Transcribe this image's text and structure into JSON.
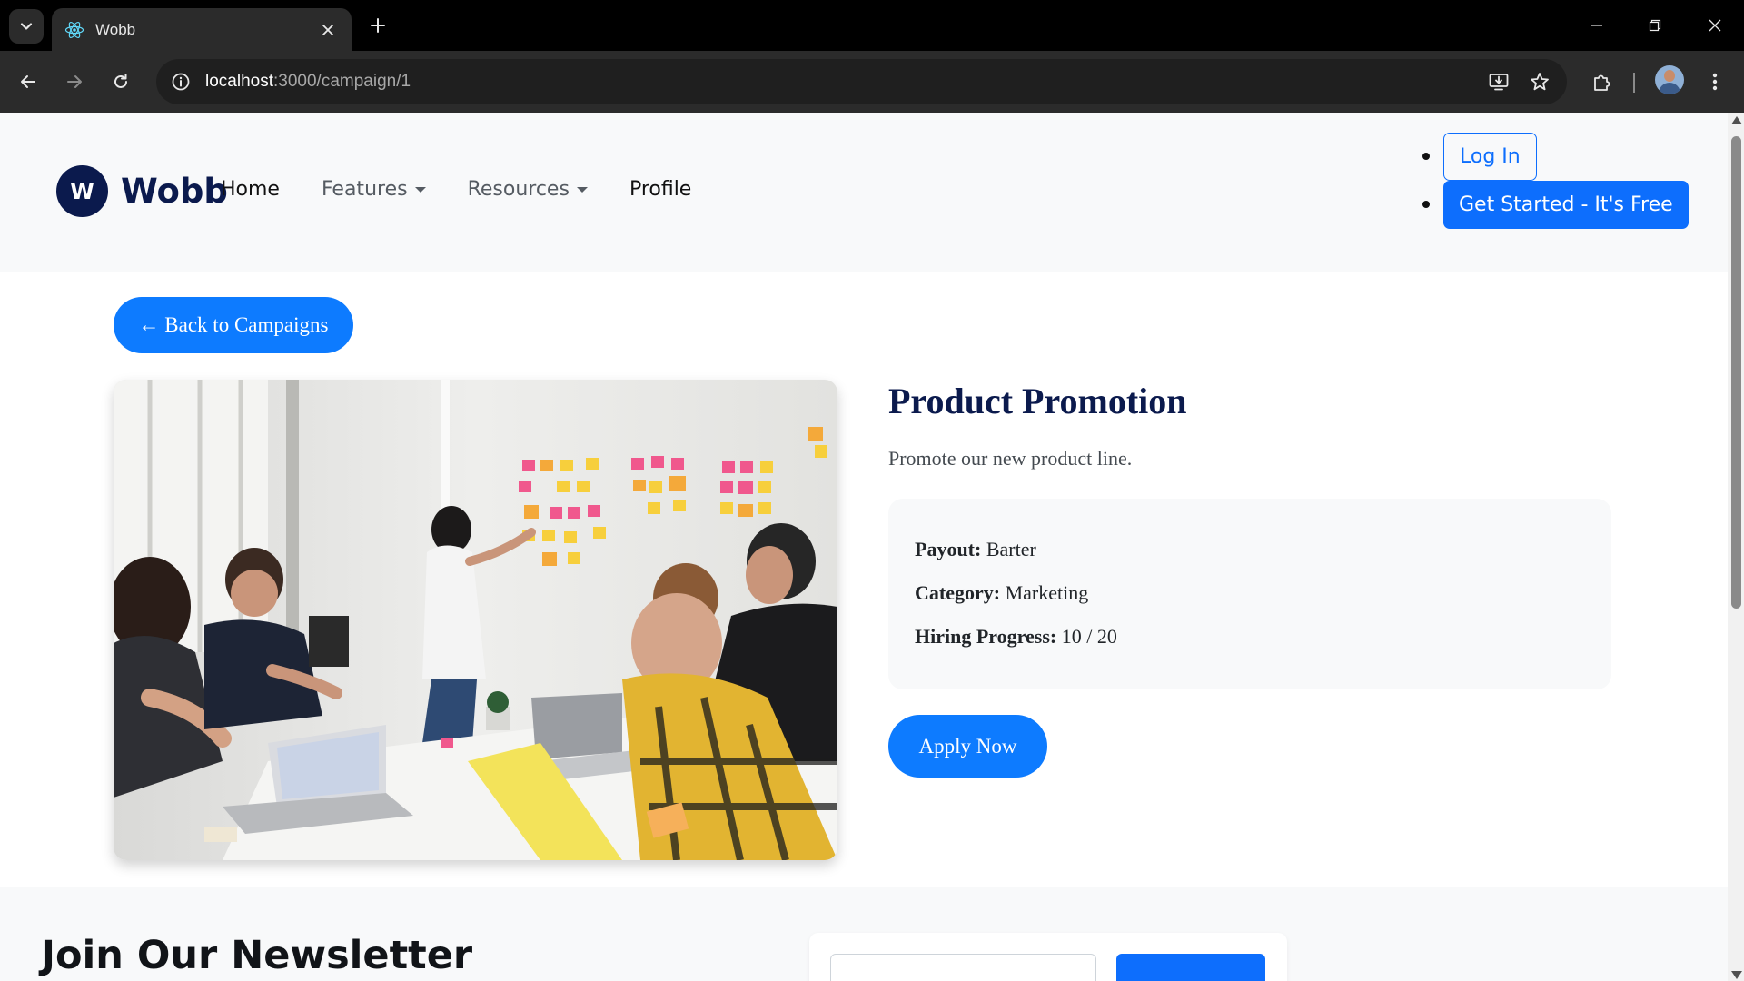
{
  "browser": {
    "tab_title": "Wobb",
    "url_host": "localhost",
    "url_path": ":3000/campaign/1"
  },
  "header": {
    "brand_initial": "W",
    "brand_name": "Wobb",
    "nav": [
      {
        "label": "Home",
        "dropdown": false
      },
      {
        "label": "Features",
        "dropdown": true
      },
      {
        "label": "Resources",
        "dropdown": true
      },
      {
        "label": "Profile",
        "dropdown": false
      }
    ],
    "login_label": "Log In",
    "get_started_label": "Get Started - It's Free"
  },
  "campaign": {
    "back_label": "← Back to Campaigns",
    "title": "Product Promotion",
    "description": "Promote our new product line.",
    "payout_label": "Payout:",
    "payout_value": "Barter",
    "category_label": "Category:",
    "category_value": "Marketing",
    "progress_label": "Hiring Progress:",
    "progress_value": "10 / 20",
    "apply_label": "Apply Now"
  },
  "newsletter": {
    "title": "Join Our Newsletter"
  },
  "colors": {
    "primary": "#0d6efd",
    "brand_navy": "#0b1a4d",
    "header_bg": "#f8f9fa"
  },
  "icons": {
    "favicon": "react-icon",
    "tab_search": "chevron-down-icon",
    "new_tab": "plus-icon",
    "back": "arrow-left-icon",
    "forward": "arrow-right-icon",
    "reload": "reload-icon",
    "site_info": "info-icon",
    "install": "install-icon",
    "bookmark": "star-icon",
    "extensions": "puzzle-icon",
    "menu": "kebab-menu-icon"
  }
}
